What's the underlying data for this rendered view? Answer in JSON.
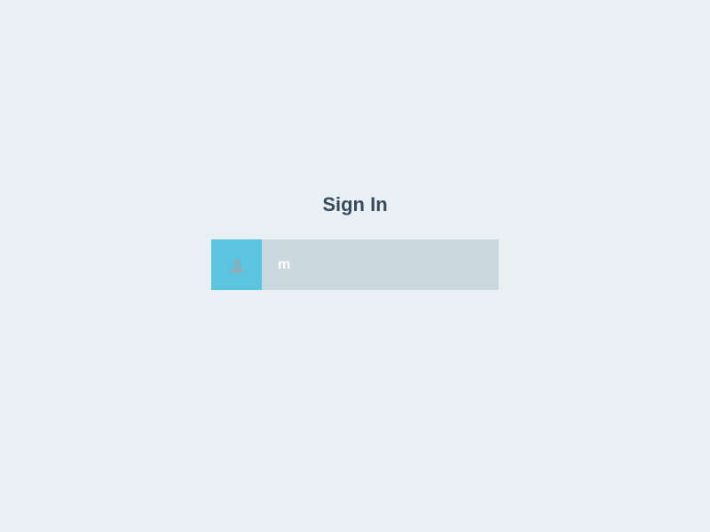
{
  "signin": {
    "title": "Sign In",
    "username_value": "m",
    "username_placeholder": ""
  }
}
